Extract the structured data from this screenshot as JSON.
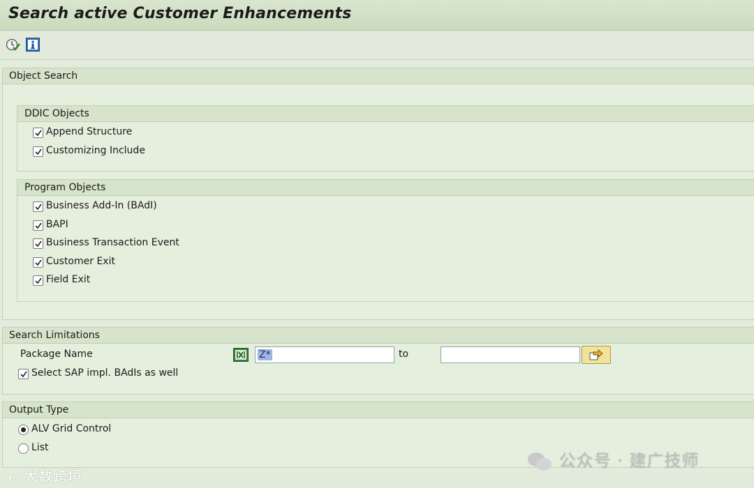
{
  "window": {
    "title": "Search active Customer Enhancements"
  },
  "toolbar": {
    "items": [
      {
        "icon": "execute-icon"
      },
      {
        "icon": "info-icon"
      }
    ]
  },
  "object_search": {
    "heading": "Object Search",
    "ddic": {
      "heading": "DDIC Objects",
      "items": [
        {
          "label": "Append Structure",
          "checked": true
        },
        {
          "label": "Customizing Include",
          "checked": true
        }
      ]
    },
    "program": {
      "heading": "Program Objects",
      "items": [
        {
          "label": "Business Add-In (BAdI)",
          "checked": true
        },
        {
          "label": "BAPI",
          "checked": true
        },
        {
          "label": "Business Transaction Event",
          "checked": true
        },
        {
          "label": "Customer Exit",
          "checked": true
        },
        {
          "label": "Field Exit",
          "checked": true
        }
      ]
    }
  },
  "search_limitations": {
    "heading": "Search Limitations",
    "package_label": "Package Name",
    "package_from": "Z*",
    "to_label": "to",
    "package_to": "",
    "sap_badis_label": "Select SAP impl. BAdIs as well",
    "sap_badis_checked": true
  },
  "output_type": {
    "heading": "Output Type",
    "options": [
      {
        "label": "ALV Grid Control",
        "selected": true
      },
      {
        "label": "List",
        "selected": false
      }
    ]
  },
  "watermark": {
    "left": "大数跨境",
    "right": "公众号 · 建广技师"
  },
  "colors": {
    "title_bar": "#c9dbbd",
    "background": "#e3ecdc",
    "frame_header": "#d6e4cb",
    "multi_select_icon": "#3b7d3b",
    "input_selection": "#9fb8e0"
  }
}
